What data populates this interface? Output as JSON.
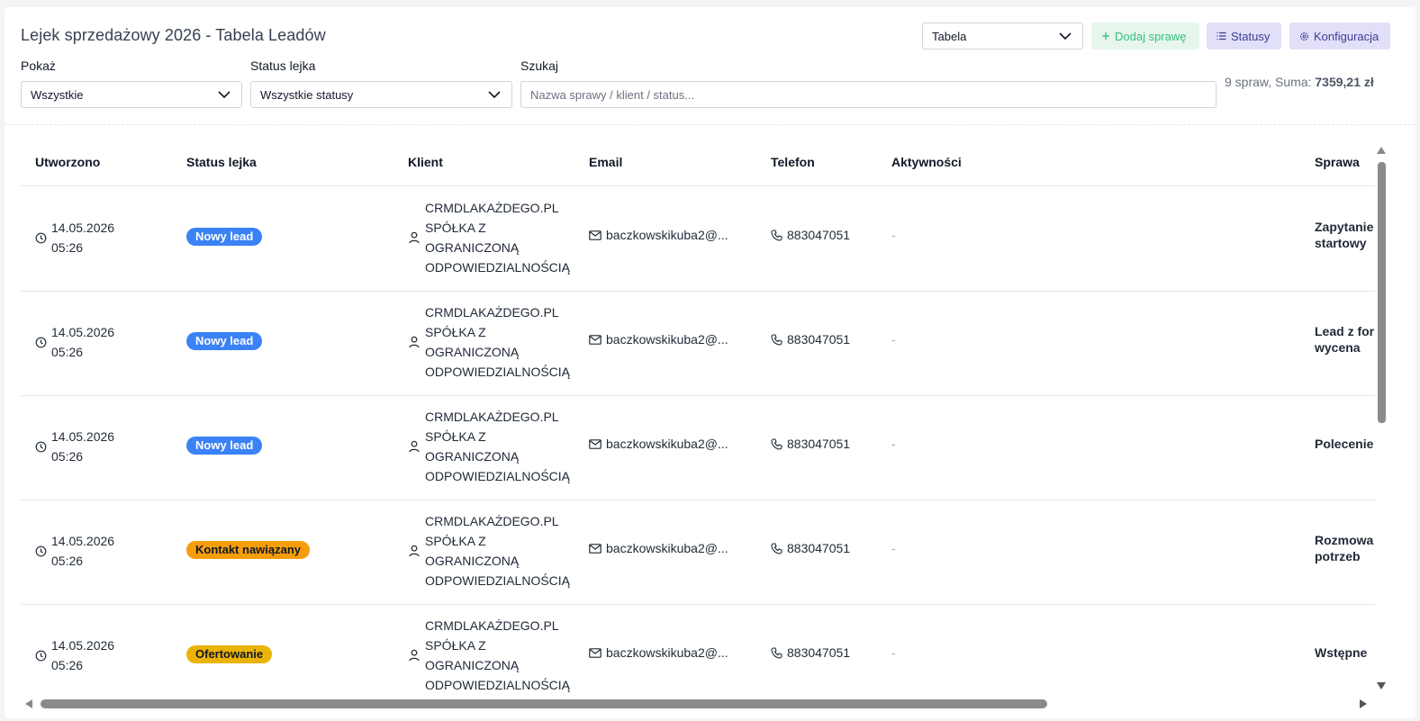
{
  "page": {
    "title": "Lejek sprzedażowy 2026 - Tabela Leadów"
  },
  "toolbar": {
    "view_select": "Tabela",
    "add_label": "Dodaj sprawę",
    "statuses_label": "Statusy",
    "config_label": "Konfiguracja"
  },
  "filters": {
    "show_label": "Pokaż",
    "show_value": "Wszystkie",
    "status_label": "Status lejka",
    "status_value": "Wszystkie statusy",
    "search_label": "Szukaj",
    "search_placeholder": "Nazwa sprawy / klient / status..."
  },
  "summary": {
    "prefix": "9 spraw, Suma: ",
    "total": "7359,21 zł"
  },
  "table": {
    "headers": [
      "Utworzono",
      "Status lejka",
      "Klient",
      "Email",
      "Telefon",
      "Aktywności",
      "Sprawa"
    ],
    "rows": [
      {
        "date": "14.05.2026",
        "time": "05:26",
        "status": "Nowy lead",
        "status_color": "#3b82f6",
        "status_text_color": "#ffffff",
        "client": [
          "CRMDLAKAŻDEGO.PL",
          "SPÓŁKA Z",
          "OGRANICZONĄ",
          "ODPOWIEDZIALNOŚCIĄ"
        ],
        "email": "baczkowskikuba2@...",
        "phone": "883047051",
        "activities": "-",
        "case": [
          "Zapytanie",
          "startowy"
        ]
      },
      {
        "date": "14.05.2026",
        "time": "05:26",
        "status": "Nowy lead",
        "status_color": "#3b82f6",
        "status_text_color": "#ffffff",
        "client": [
          "CRMDLAKAŻDEGO.PL",
          "SPÓŁKA Z",
          "OGRANICZONĄ",
          "ODPOWIEDZIALNOŚCIĄ"
        ],
        "email": "baczkowskikuba2@...",
        "phone": "883047051",
        "activities": "-",
        "case": [
          "Lead z for",
          "wycena"
        ]
      },
      {
        "date": "14.05.2026",
        "time": "05:26",
        "status": "Nowy lead",
        "status_color": "#3b82f6",
        "status_text_color": "#ffffff",
        "client": [
          "CRMDLAKAŻDEGO.PL",
          "SPÓŁKA Z",
          "OGRANICZONĄ",
          "ODPOWIEDZIALNOŚCIĄ"
        ],
        "email": "baczkowskikuba2@...",
        "phone": "883047051",
        "activities": "-",
        "case": [
          "Polecenie",
          ""
        ]
      },
      {
        "date": "14.05.2026",
        "time": "05:26",
        "status": "Kontakt nawiązany",
        "status_color": "#f59e0b",
        "status_text_color": "#111827",
        "client": [
          "CRMDLAKAŻDEGO.PL",
          "SPÓŁKA Z",
          "OGRANICZONĄ",
          "ODPOWIEDZIALNOŚCIĄ"
        ],
        "email": "baczkowskikuba2@...",
        "phone": "883047051",
        "activities": "-",
        "case": [
          "Rozmowa",
          "potrzeb"
        ]
      },
      {
        "date": "14.05.2026",
        "time": "05:26",
        "status": "Ofertowanie",
        "status_color": "#eab308",
        "status_text_color": "#111827",
        "client": [
          "CRMDLAKAŻDEGO.PL",
          "SPÓŁKA Z",
          "OGRANICZONĄ",
          "ODPOWIEDZIALNOŚCIĄ"
        ],
        "email": "baczkowskikuba2@...",
        "phone": "883047051",
        "activities": "-",
        "case": [
          "Wstępne",
          ""
        ]
      }
    ]
  },
  "icons": {
    "clock": "clock-icon",
    "user": "user-icon",
    "mail": "mail-icon",
    "phone": "phone-icon",
    "plus": "plus-icon",
    "list": "list-icon",
    "gear": "gear-icon",
    "chevron": "chevron-down-icon"
  }
}
